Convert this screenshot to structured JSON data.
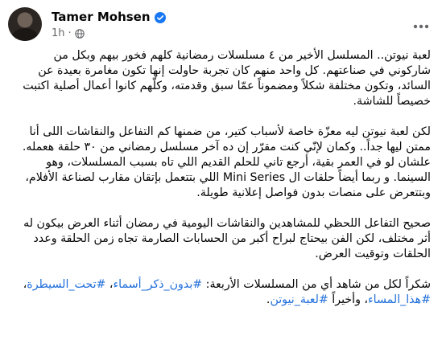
{
  "post": {
    "author": "Tamer Mohsen",
    "time": "1h",
    "menu_icon": "more-horizontal-icon",
    "paragraphs": [
      "لعبة نيوتن.. المسلسل الأخير من ٤ مسلسلات رمضانية كلهم فخور بيهم وبكل من شاركوني في صناعتهم. كل واحد منهم كان تجربة حاولت إنها تكون مغامرة بعيدة عن السائد، وتكون مختلفة شكلاً ومضموناً عمّا سبق وقدمته، وكلّهم كانوا أعمال أصلية اكتبت خصيصاً للشاشة.",
      "لكن لعبة نيوتن ليه معزّة خاصة لأسباب كتير، من ضمنها كم التفاعل والنقاشات اللى أنا ممتن ليها جداً.. وكمان لإنّي كنت مقرّر إن ده آخر مسلسل رمضاني من ٣٠ حلقة هعمله. علشان لو في العمر بقية، أرجع تاني للحلم القديم اللي تاه بسبب المسلسلات، وهو السينما. و ربما أيضاً حلقات ال Mini Series اللي بتتعمل بإتقان مقارب لصناعة الأفلام، وبتتعرض على منصات بدون فواصل إعلانية طويلة.",
      "صحيح التفاعل اللحظي للمشاهدين والنقاشات اليومية في رمضان أثناء العرض بيكون له أثر مختلف، لكن الفن بيحتاج لبراح أكبر من الحسابات الصارمة تجاه زمن الحلقة وعدد الحلقات وتوقيت العرض."
    ],
    "closing": {
      "lead": "شكراً لكل من شاهد أي من المسلسلات الأربعة: ",
      "tag1": "#بدون_ذكر_أسماء",
      "comma1": "، ",
      "tag2": "#تحت_السيطرة",
      "comma2": "، ",
      "tag3": "#هذا_المساء",
      "middle": "، وأخيراً ",
      "tag4": "#لعبة_نيوتن",
      "end": "."
    }
  }
}
